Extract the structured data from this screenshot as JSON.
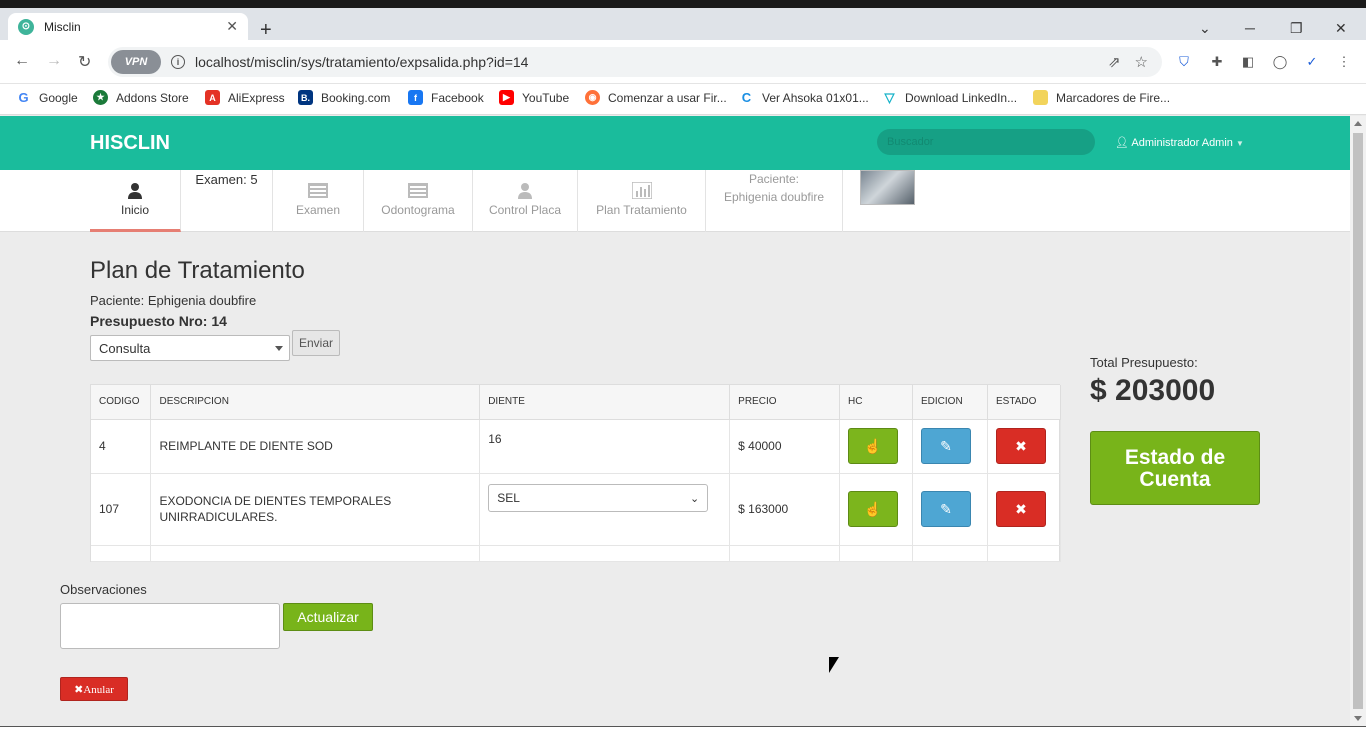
{
  "browser": {
    "tab_title": "Misclin",
    "tab_close": "✕",
    "new_tab": "+",
    "vpn": "VPN",
    "url": "localhost/misclin/sys/tratamiento/expsalida.php?id=14"
  },
  "bookmarks": [
    {
      "label": "Google",
      "icon": "G",
      "color": "#4285f4"
    },
    {
      "label": "Addons Store",
      "icon": "★",
      "color": "#1b7a3a"
    },
    {
      "label": "AliExpress",
      "icon": "A",
      "color": "#e43225"
    },
    {
      "label": "Booking.com",
      "icon": "B.",
      "color": "#003580"
    },
    {
      "label": "Facebook",
      "icon": "f",
      "color": "#1877f2"
    },
    {
      "label": "YouTube",
      "icon": "▶",
      "color": "#ff0000"
    },
    {
      "label": "Comenzar a usar Fir...",
      "icon": "◉",
      "color": "#ff7139"
    },
    {
      "label": "Ver Ahsoka 01x01...",
      "icon": "C",
      "color": "#1a8fe3"
    },
    {
      "label": "Download LinkedIn...",
      "icon": "▽",
      "color": "#17b3c9"
    },
    {
      "label": "Marcadores de Fire...",
      "icon": "",
      "color": "#f2d45c"
    }
  ],
  "app": {
    "brand": "HISCLIN",
    "search_placeholder": "Buscador",
    "user": "Administrador Admin"
  },
  "subnav": {
    "inicio": "Inicio",
    "examen_count": "Examen: 5",
    "examen": "Examen",
    "odontograma": "Odontograma",
    "control_placa": "Control Placa",
    "plan_tratamiento": "Plan Tratamiento",
    "paciente_label": "Paciente:",
    "paciente_name": "Ephigenia doubfire"
  },
  "main": {
    "title": "Plan de Tratamiento",
    "paciente": "Paciente: Ephigenia doubfire",
    "presupuesto": "Presupuesto Nro: 14",
    "select_value": "Consulta",
    "enviar": "Enviar",
    "total_label": "Total Presupuesto:",
    "total_value": "$ 203000",
    "estado_btn": "Estado de Cuenta",
    "observaciones": "Observaciones",
    "actualizar": "Actualizar",
    "anular": "✖Anular"
  },
  "table": {
    "headers": [
      "CODIGO",
      "DESCRIPCION",
      "DIENTE",
      "PRECIO",
      "HC",
      "EDICION",
      "ESTADO"
    ],
    "rows": [
      {
        "codigo": "4",
        "descripcion": "REIMPLANTE DE DIENTE SOD",
        "diente": "16",
        "precio": "$ 40000"
      },
      {
        "codigo": "107",
        "descripcion": "EXODONCIA DE DIENTES TEMPORALES UNIRRADICULARES.",
        "diente_select": "SEL",
        "precio": "$ 163000"
      }
    ]
  },
  "colors": {
    "header": "#1abc9c",
    "green_button": "#78b41a",
    "blue_button": "#4ea6d3",
    "red_button": "#d92d25"
  }
}
